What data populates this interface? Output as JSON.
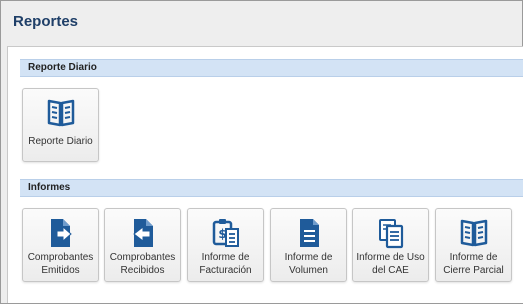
{
  "page": {
    "title": "Reportes"
  },
  "sections": [
    {
      "title": "Reporte Diario",
      "tiles": [
        {
          "label_lines": [
            "Reporte Diario"
          ],
          "icon": "open-book-icon"
        }
      ]
    },
    {
      "title": "Informes",
      "tiles": [
        {
          "label_lines": [
            "Comprobantes",
            "Emitidos"
          ],
          "icon": "document-export-icon"
        },
        {
          "label_lines": [
            "Comprobantes",
            "Recibidos"
          ],
          "icon": "document-import-icon"
        },
        {
          "label_lines": [
            "Informe de",
            "Facturación"
          ],
          "icon": "clipboard-money-icon"
        },
        {
          "label_lines": [
            "Informe de",
            "Volumen"
          ],
          "icon": "document-lines-icon"
        },
        {
          "label_lines": [
            "Informe de Uso",
            "del CAE"
          ],
          "icon": "documents-stack-icon"
        },
        {
          "label_lines": [
            "Informe de",
            "Cierre Parcial"
          ],
          "icon": "open-book-icon"
        }
      ]
    }
  ],
  "colors": {
    "title": "#1f3f68",
    "icon": "#1f5b9a",
    "section_header_bg": "#d3e3f5"
  }
}
